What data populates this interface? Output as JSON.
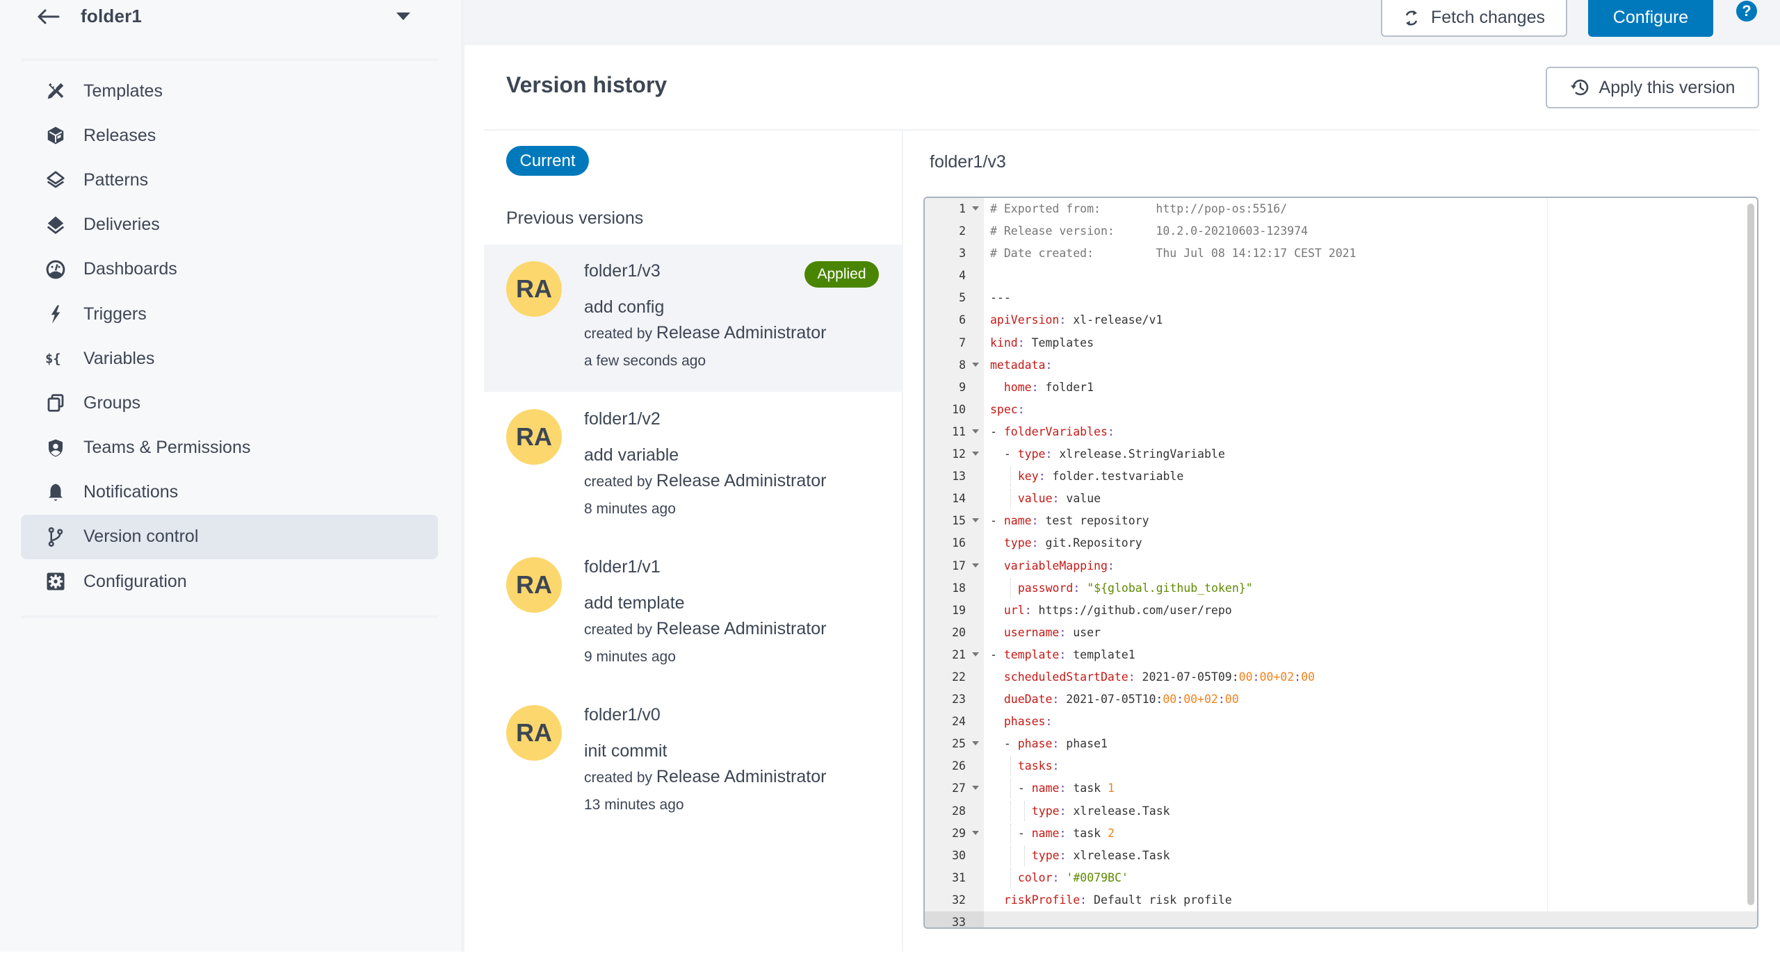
{
  "sidebar": {
    "folder_name": "folder1",
    "back_icon": "arrow-left-icon",
    "dropdown_icon": "caret-down-icon",
    "items": [
      {
        "label": "Templates",
        "icon": "templates-icon",
        "active": false
      },
      {
        "label": "Releases",
        "icon": "releases-icon",
        "active": false
      },
      {
        "label": "Patterns",
        "icon": "patterns-icon",
        "active": false
      },
      {
        "label": "Deliveries",
        "icon": "deliveries-icon",
        "active": false
      },
      {
        "label": "Dashboards",
        "icon": "dashboards-icon",
        "active": false
      },
      {
        "label": "Triggers",
        "icon": "triggers-icon",
        "active": false
      },
      {
        "label": "Variables",
        "icon": "variables-icon",
        "active": false
      },
      {
        "label": "Groups",
        "icon": "groups-icon",
        "active": false
      },
      {
        "label": "Teams & Permissions",
        "icon": "teams-permissions-icon",
        "active": false
      },
      {
        "label": "Notifications",
        "icon": "notifications-icon",
        "active": false
      },
      {
        "label": "Version control",
        "icon": "version-control-icon",
        "active": true
      },
      {
        "label": "Configuration",
        "icon": "configuration-icon",
        "active": false
      }
    ]
  },
  "topbar": {
    "fetch_label": "Fetch changes",
    "configure_label": "Configure",
    "help_label": "?"
  },
  "main": {
    "title": "Version history",
    "apply_label": "Apply this version",
    "current_badge": "Current",
    "previous_label": "Previous versions",
    "versions": [
      {
        "initials": "RA",
        "name": "folder1/v3",
        "message": "add config",
        "created_by_prefix": "created by",
        "author": "Release Administrator",
        "time": "a few seconds ago",
        "badge": "Applied",
        "selected": true
      },
      {
        "initials": "RA",
        "name": "folder1/v2",
        "message": "add variable",
        "created_by_prefix": "created by",
        "author": "Release Administrator",
        "time": "8 minutes ago",
        "badge": null,
        "selected": false
      },
      {
        "initials": "RA",
        "name": "folder1/v1",
        "message": "add template",
        "created_by_prefix": "created by",
        "author": "Release Administrator",
        "time": "9 minutes ago",
        "badge": null,
        "selected": false
      },
      {
        "initials": "RA",
        "name": "folder1/v0",
        "message": "init commit",
        "created_by_prefix": "created by",
        "author": "Release Administrator",
        "time": "13 minutes ago",
        "badge": null,
        "selected": false
      }
    ]
  },
  "editor": {
    "title": "folder1/v3",
    "cursor_line": 33,
    "lines": [
      {
        "n": 1,
        "fold": true,
        "tokens": [
          [
            "c",
            "# Exported from:        http://pop-os:5516/"
          ]
        ]
      },
      {
        "n": 2,
        "fold": false,
        "tokens": [
          [
            "c",
            "# Release version:      10.2.0-20210603-123974"
          ]
        ]
      },
      {
        "n": 3,
        "fold": false,
        "tokens": [
          [
            "c",
            "# Date created:         Thu Jul 08 14:12:17 CEST 2021"
          ]
        ]
      },
      {
        "n": 4,
        "fold": false,
        "tokens": []
      },
      {
        "n": 5,
        "fold": false,
        "tokens": [
          [
            "t",
            "---"
          ]
        ]
      },
      {
        "n": 6,
        "fold": false,
        "tokens": [
          [
            "k",
            "apiVersion"
          ],
          [
            "p",
            ":"
          ],
          [
            "t",
            " xl-release/v1"
          ]
        ]
      },
      {
        "n": 7,
        "fold": false,
        "tokens": [
          [
            "k",
            "kind"
          ],
          [
            "p",
            ":"
          ],
          [
            "t",
            " Templates"
          ]
        ]
      },
      {
        "n": 8,
        "fold": true,
        "tokens": [
          [
            "k",
            "metadata"
          ],
          [
            "p",
            ":"
          ]
        ]
      },
      {
        "n": 9,
        "fold": false,
        "tokens": [
          [
            "t",
            "  "
          ],
          [
            "k",
            "home"
          ],
          [
            "p",
            ":"
          ],
          [
            "t",
            " folder1"
          ]
        ]
      },
      {
        "n": 10,
        "fold": false,
        "tokens": [
          [
            "k",
            "spec"
          ],
          [
            "p",
            ":"
          ]
        ]
      },
      {
        "n": 11,
        "fold": true,
        "tokens": [
          [
            "t",
            "- "
          ],
          [
            "k",
            "folderVariables"
          ],
          [
            "p",
            ":"
          ]
        ]
      },
      {
        "n": 12,
        "fold": true,
        "tokens": [
          [
            "t",
            "  - "
          ],
          [
            "k",
            "type"
          ],
          [
            "p",
            ":"
          ],
          [
            "t",
            " xlrelease.StringVariable"
          ]
        ]
      },
      {
        "n": 13,
        "fold": false,
        "tokens": [
          [
            "t",
            "  "
          ],
          [
            "g",
            ""
          ],
          [
            "k",
            "key"
          ],
          [
            "p",
            ":"
          ],
          [
            "t",
            " folder.testvariable"
          ]
        ]
      },
      {
        "n": 14,
        "fold": false,
        "tokens": [
          [
            "t",
            "  "
          ],
          [
            "g",
            ""
          ],
          [
            "k",
            "value"
          ],
          [
            "p",
            ":"
          ],
          [
            "t",
            " value"
          ]
        ]
      },
      {
        "n": 15,
        "fold": true,
        "tokens": [
          [
            "t",
            "- "
          ],
          [
            "k",
            "name"
          ],
          [
            "p",
            ":"
          ],
          [
            "t",
            " test repository"
          ]
        ]
      },
      {
        "n": 16,
        "fold": false,
        "tokens": [
          [
            "t",
            "  "
          ],
          [
            "k",
            "type"
          ],
          [
            "p",
            ":"
          ],
          [
            "t",
            " git.Repository"
          ]
        ]
      },
      {
        "n": 17,
        "fold": true,
        "tokens": [
          [
            "t",
            "  "
          ],
          [
            "k",
            "variableMapping"
          ],
          [
            "p",
            ":"
          ]
        ]
      },
      {
        "n": 18,
        "fold": false,
        "tokens": [
          [
            "t",
            "  "
          ],
          [
            "g",
            ""
          ],
          [
            "k",
            "password"
          ],
          [
            "p",
            ":"
          ],
          [
            "t",
            " "
          ],
          [
            "s",
            "\"${global.github_token}\""
          ]
        ]
      },
      {
        "n": 19,
        "fold": false,
        "tokens": [
          [
            "t",
            "  "
          ],
          [
            "k",
            "url"
          ],
          [
            "p",
            ":"
          ],
          [
            "t",
            " https://github.com/user/repo"
          ]
        ]
      },
      {
        "n": 20,
        "fold": false,
        "tokens": [
          [
            "t",
            "  "
          ],
          [
            "k",
            "username"
          ],
          [
            "p",
            ":"
          ],
          [
            "t",
            " user"
          ]
        ]
      },
      {
        "n": 21,
        "fold": true,
        "tokens": [
          [
            "t",
            "- "
          ],
          [
            "k",
            "template"
          ],
          [
            "p",
            ":"
          ],
          [
            "t",
            " template1"
          ]
        ]
      },
      {
        "n": 22,
        "fold": false,
        "tokens": [
          [
            "t",
            "  "
          ],
          [
            "k",
            "scheduledStartDate"
          ],
          [
            "p",
            ":"
          ],
          [
            "t",
            " 2021-07-05T09:"
          ],
          [
            "n",
            "00"
          ],
          [
            "p",
            ":"
          ],
          [
            "n",
            "00+02"
          ],
          [
            "p",
            ":"
          ],
          [
            "n",
            "00"
          ]
        ]
      },
      {
        "n": 23,
        "fold": false,
        "tokens": [
          [
            "t",
            "  "
          ],
          [
            "k",
            "dueDate"
          ],
          [
            "p",
            ":"
          ],
          [
            "t",
            " 2021-07-05T10:"
          ],
          [
            "n",
            "00"
          ],
          [
            "p",
            ":"
          ],
          [
            "n",
            "00+02"
          ],
          [
            "p",
            ":"
          ],
          [
            "n",
            "00"
          ]
        ]
      },
      {
        "n": 24,
        "fold": false,
        "tokens": [
          [
            "t",
            "  "
          ],
          [
            "k",
            "phases"
          ],
          [
            "p",
            ":"
          ]
        ]
      },
      {
        "n": 25,
        "fold": true,
        "tokens": [
          [
            "t",
            "  - "
          ],
          [
            "k",
            "phase"
          ],
          [
            "p",
            ":"
          ],
          [
            "t",
            " phase1"
          ]
        ]
      },
      {
        "n": 26,
        "fold": false,
        "tokens": [
          [
            "t",
            "  "
          ],
          [
            "g",
            ""
          ],
          [
            "k",
            "tasks"
          ],
          [
            "p",
            ":"
          ]
        ]
      },
      {
        "n": 27,
        "fold": true,
        "tokens": [
          [
            "t",
            "  "
          ],
          [
            "g",
            ""
          ],
          [
            "t",
            "- "
          ],
          [
            "k",
            "name"
          ],
          [
            "p",
            ":"
          ],
          [
            "t",
            " task "
          ],
          [
            "n",
            "1"
          ]
        ]
      },
      {
        "n": 28,
        "fold": false,
        "tokens": [
          [
            "t",
            "  "
          ],
          [
            "g",
            ""
          ],
          [
            "g",
            ""
          ],
          [
            "k",
            "type"
          ],
          [
            "p",
            ":"
          ],
          [
            "t",
            " xlrelease.Task"
          ]
        ]
      },
      {
        "n": 29,
        "fold": true,
        "tokens": [
          [
            "t",
            "  "
          ],
          [
            "g",
            ""
          ],
          [
            "t",
            "- "
          ],
          [
            "k",
            "name"
          ],
          [
            "p",
            ":"
          ],
          [
            "t",
            " task "
          ],
          [
            "n",
            "2"
          ]
        ]
      },
      {
        "n": 30,
        "fold": false,
        "tokens": [
          [
            "t",
            "  "
          ],
          [
            "g",
            ""
          ],
          [
            "g",
            ""
          ],
          [
            "k",
            "type"
          ],
          [
            "p",
            ":"
          ],
          [
            "t",
            " xlrelease.Task"
          ]
        ]
      },
      {
        "n": 31,
        "fold": false,
        "tokens": [
          [
            "t",
            "  "
          ],
          [
            "g",
            ""
          ],
          [
            "k",
            "color"
          ],
          [
            "p",
            ":"
          ],
          [
            "t",
            " "
          ],
          [
            "s",
            "'#0079BC'"
          ]
        ]
      },
      {
        "n": 32,
        "fold": false,
        "tokens": [
          [
            "t",
            "  "
          ],
          [
            "k",
            "riskProfile"
          ],
          [
            "p",
            ":"
          ],
          [
            "t",
            " Default risk profile"
          ]
        ]
      },
      {
        "n": 33,
        "fold": false,
        "tokens": []
      }
    ]
  },
  "colors": {
    "accent": "#0079bc",
    "applied_badge": "#498500",
    "avatar": "#fbd76d",
    "yaml_key": "#c41a16",
    "yaml_string": "#5f8a00",
    "yaml_number": "#f0831e"
  }
}
